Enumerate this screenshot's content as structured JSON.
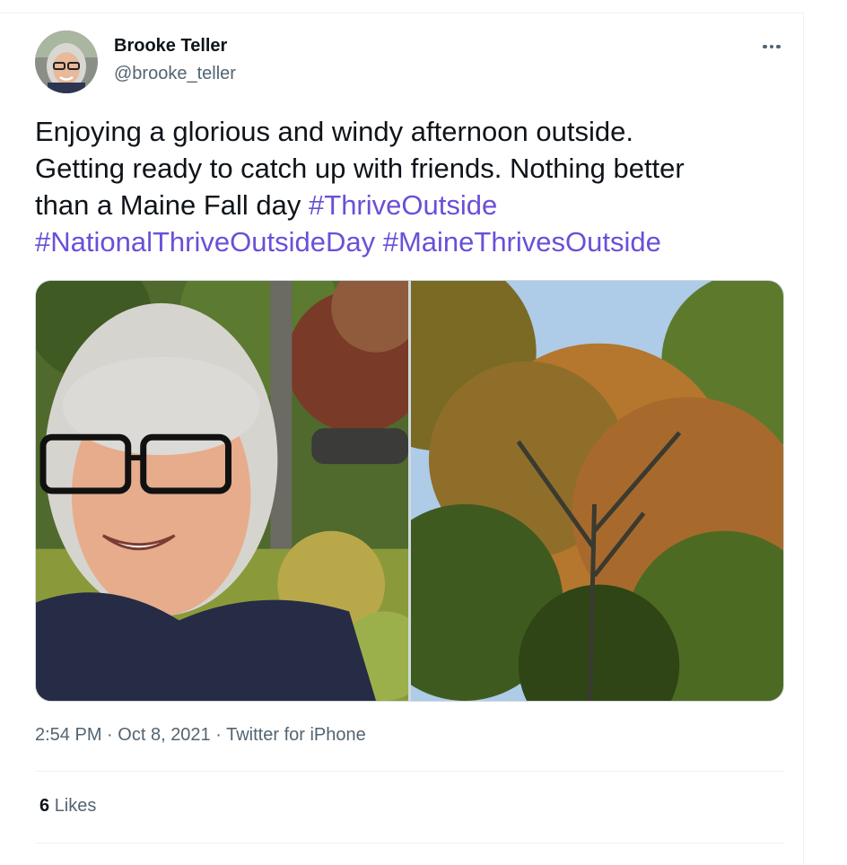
{
  "tweet": {
    "author": {
      "name": "Brooke Teller",
      "handle": "@brooke_teller"
    },
    "text_parts": {
      "line1": "Enjoying a glorious and windy afternoon outside.",
      "line2": "Getting ready to catch up with friends. Nothing better",
      "line3_plain": "than a Maine Fall day ",
      "hashtag1": "#ThriveOutside",
      "hashtag2": "#NationalThriveOutsideDay",
      "hashtag3": "#MaineThrivesOutside"
    },
    "meta": {
      "time": "2:54 PM",
      "date": "Oct 8, 2021",
      "source": "Twitter for iPhone",
      "separator": "·"
    },
    "likes": {
      "count": "6",
      "label": "Likes"
    },
    "colors": {
      "hashtag": "#6b4fd8",
      "secondary_text": "#536471",
      "primary_text": "#0f1419"
    },
    "icons": {
      "more": "more-horizontal-icon"
    }
  }
}
